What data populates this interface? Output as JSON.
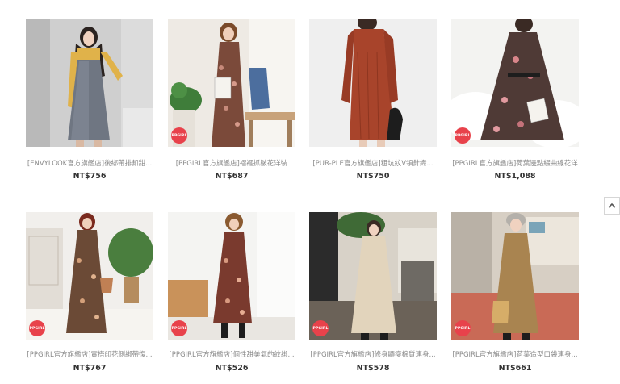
{
  "products": [
    {
      "title": "[ENVYLOOK官方旗艦店]後綁帶排釦甜...",
      "price": "NT$756",
      "badge": ""
    },
    {
      "title": "[PPGIRL官方旗艦店]褶襬抓皺花洋裝",
      "price": "NT$687",
      "badge": "PPGIRL"
    },
    {
      "title": "[PUR-PLE官方旗艦店]粗坑紋V領針織...",
      "price": "NT$750",
      "badge": ""
    },
    {
      "title": "[PPGIRL官方旗艦店]荷葉邊點綴曲線花洋",
      "price": "NT$1,088",
      "badge": "PPGIRL"
    },
    {
      "title": "[PPGIRL官方旗艦店]實搭印花側綁帶復...",
      "price": "NT$767",
      "badge": "PPGIRL"
    },
    {
      "title": "[PPGIRL官方旗艦店]個性甜美氣的紋綁...",
      "price": "NT$526",
      "badge": "PPGIRL"
    },
    {
      "title": "[PPGIRL官方旗艦店]修身顯瘦棉質連身...",
      "price": "NT$578",
      "badge": "PPGIRL"
    },
    {
      "title": "[PPGIRL官方旗艦店]荷葉造型口袋連身...",
      "price": "NT$661",
      "badge": "PPGIRL"
    }
  ],
  "colors": {
    "badge": "#e8424b",
    "price": "#333333",
    "title": "#8a8a8a"
  },
  "icons": {
    "back_to_top": "chevron-up-icon"
  }
}
